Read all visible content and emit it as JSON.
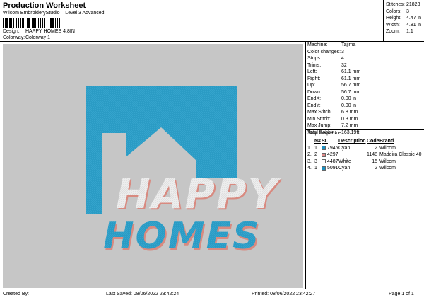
{
  "header": {
    "title": "Production Worksheet",
    "subtitle": "Wilcom EmbroideryStudio – Level 3 Advanced",
    "design_label": "Design:",
    "design_value": "HAPPY HOMES 4,8IN",
    "colorway_label": "Colorway:",
    "colorway_value": "Colorway 1"
  },
  "stats": [
    {
      "label": "Stitches:",
      "value": "21823"
    },
    {
      "label": "Colors:",
      "value": "3"
    },
    {
      "label": "Height:",
      "value": "4.47 in"
    },
    {
      "label": "Width:",
      "value": "4.81 in"
    },
    {
      "label": "Zoom:",
      "value": "1:1"
    }
  ],
  "details": [
    {
      "label": "Machine:",
      "value": "Tajima"
    },
    {
      "label": "Color changes:",
      "value": "3"
    },
    {
      "label": "Stops:",
      "value": "4"
    },
    {
      "label": "Trims:",
      "value": "32"
    },
    {
      "label": "Left:",
      "value": "61.1 mm"
    },
    {
      "label": "Right:",
      "value": "61.1 mm"
    },
    {
      "label": "Up:",
      "value": "56.7 mm"
    },
    {
      "label": "Down:",
      "value": "56.7 mm"
    },
    {
      "label": "EndX:",
      "value": "0.00 in"
    },
    {
      "label": "EndY:",
      "value": "0.00 in"
    },
    {
      "label": "Max Stitch:",
      "value": "6.8 mm"
    },
    {
      "label": "Min Stitch:",
      "value": "0.3 mm"
    },
    {
      "label": "Max Jump:",
      "value": "7.2 mm"
    },
    {
      "label": "Total Bobbin:",
      "value": "163.19ft"
    }
  ],
  "stop_sequence": {
    "title": "Stop Sequence:",
    "headers": [
      "N#",
      "St.",
      "Description",
      "Code",
      "Brand"
    ],
    "rows": [
      {
        "idx": "1.",
        "n": "1",
        "color": "#1a8fc0",
        "st": "7946",
        "desc": "Cyan",
        "code": "2",
        "brand": "Wilcom"
      },
      {
        "idx": "2.",
        "n": "2",
        "color": "#e08a8a",
        "st": "4297",
        "desc": "",
        "code": "1148",
        "brand": "Madeira Classic 40"
      },
      {
        "idx": "3.",
        "n": "3",
        "color": "#ffffff",
        "st": "4487",
        "desc": "White",
        "code": "15",
        "brand": "Wilcom"
      },
      {
        "idx": "4.",
        "n": "1",
        "color": "#1a8fc0",
        "st": "5091",
        "desc": "Cyan",
        "code": "2",
        "brand": "Wilcom"
      }
    ]
  },
  "design": {
    "line1": "HAPPY",
    "line2": "HOMES",
    "colors": {
      "cyan": "#2a9bc4",
      "white": "#ececec",
      "pink": "#d88a80",
      "canvas": "#c6c6c6"
    }
  },
  "footer": {
    "created": "Created By:",
    "saved": "Last Saved: 08/06/2022 23:42:24",
    "printed": "Printed: 08/06/2022 23:42:27",
    "page": "Page 1 of 1"
  }
}
